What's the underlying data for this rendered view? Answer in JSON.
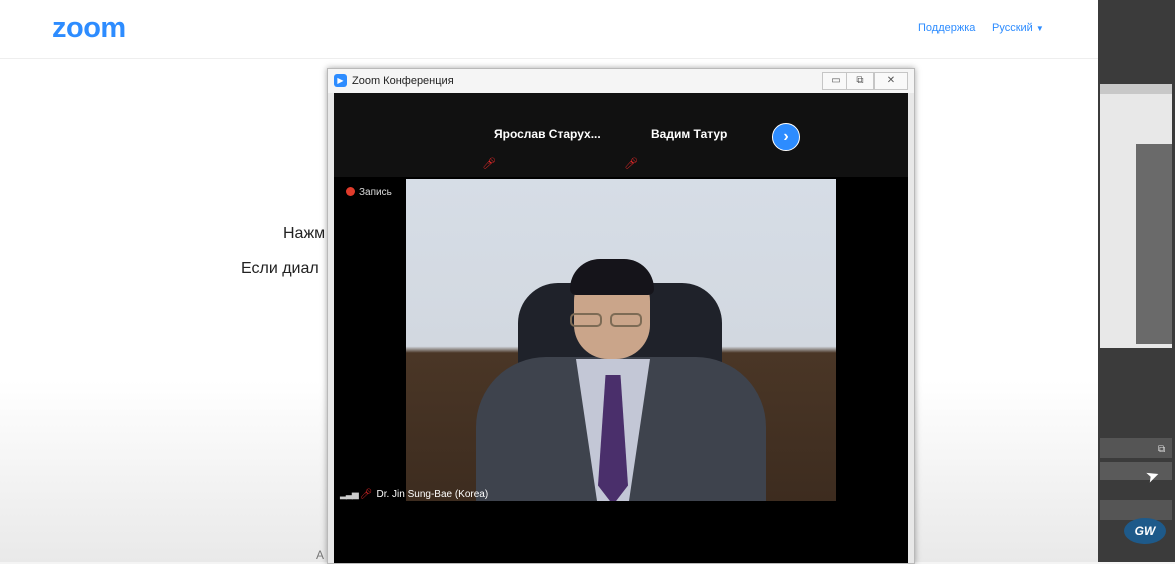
{
  "page": {
    "logo": "zoom",
    "nav": {
      "support": "Поддержка",
      "language": "Русский"
    },
    "text_line1": "Нажм",
    "text_line2": "Если диал",
    "footer_char": "А"
  },
  "window": {
    "title": "Zoom Конференция",
    "controls": {
      "minimize": "▭",
      "maximize": "⧉",
      "close": "✕"
    }
  },
  "participants": [
    {
      "name": "Ярослав  Старух...",
      "muted": true
    },
    {
      "name": "Вадим Татур",
      "muted": true
    }
  ],
  "next_label": "›",
  "recording_label": "Запись",
  "active_speaker": "Dr. Jin Sung-Bae (Korea)",
  "side_panel": {
    "logo": "GW"
  },
  "colors": {
    "brand": "#2d8cff",
    "recording": "#e03b2b",
    "muted": "#e02828"
  }
}
